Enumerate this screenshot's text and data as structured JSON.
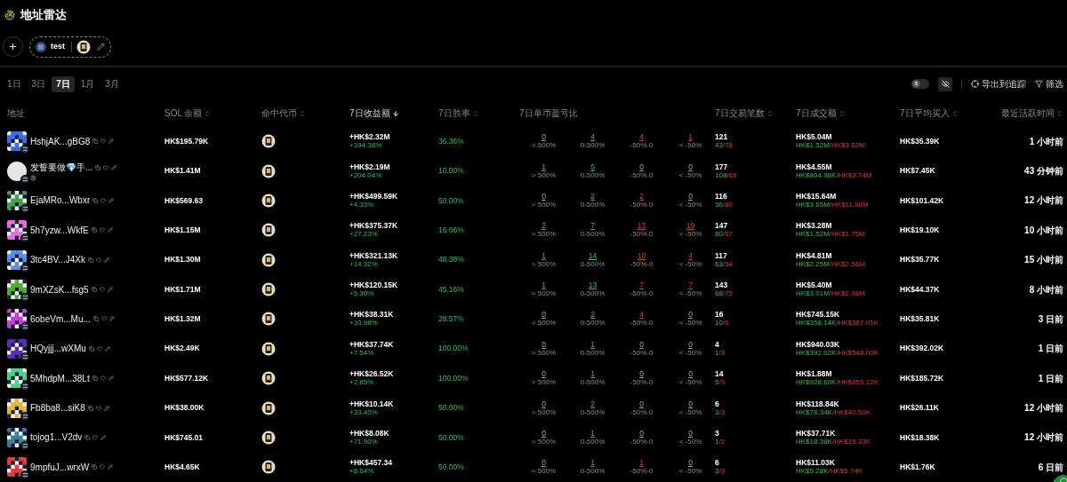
{
  "title": "地址雷达",
  "group": {
    "name": "test"
  },
  "periods": [
    {
      "label": "1日",
      "selected": false
    },
    {
      "label": "3日",
      "selected": false
    },
    {
      "label": "7日",
      "selected": true
    },
    {
      "label": "1月",
      "selected": false
    },
    {
      "label": "3月",
      "selected": false
    }
  ],
  "toolbar": {
    "currency_toggle": {
      "symbol": "$",
      "on": false
    },
    "export_label": "导出到追踪",
    "filter_label": "筛选"
  },
  "columns": [
    {
      "label": "地址",
      "sortable": false,
      "sorted": false
    },
    {
      "label": "SOL 余额",
      "sortable": true,
      "sorted": false
    },
    {
      "label": "命中代币",
      "sortable": true,
      "sorted": false
    },
    {
      "label": "7日收益额",
      "sortable": true,
      "sorted": true
    },
    {
      "label": "7日胜率",
      "sortable": true,
      "sorted": false
    },
    {
      "label": "7日单币盈亏比",
      "sortable": false,
      "sorted": false
    },
    {
      "label": "7日交易笔数",
      "sortable": true,
      "sorted": false
    },
    {
      "label": "7日成交额",
      "sortable": true,
      "sorted": false
    },
    {
      "label": "7日平均买入",
      "sortable": true,
      "sorted": false
    },
    {
      "label": "最近活跃时间",
      "sortable": true,
      "sorted": false
    }
  ],
  "rows": [
    {
      "address": "HshjAK...gBG8",
      "avatar": {
        "kind": "identicon",
        "color": "#3b6fe0"
      },
      "extra_icon": false,
      "sol": "HK$195.79K",
      "pnl": "+HK$2.32M",
      "pnl_pct": "+194.38%",
      "win_rate": "36.36%",
      "buckets": [
        {
          "count": "0",
          "range": "> 500%",
          "kind": "neutral"
        },
        {
          "count": "4",
          "range": "0-500%",
          "kind": "gain"
        },
        {
          "count": "4",
          "range": "-50%-0",
          "kind": "loss"
        },
        {
          "count": "1",
          "range": "< -50%",
          "kind": "loss"
        }
      ],
      "trades": "121",
      "wins": "43",
      "losses": "/78",
      "volume": "HK$5.04M",
      "buy_vol": "HK$1.52M",
      "sell_vol": "/HK$3.52M",
      "avg_buy": "HK$35.39K",
      "last_active": "1 小时前"
    },
    {
      "address": "发誓要做💎手...",
      "avatar": {
        "kind": "blank",
        "color": "#e5e5e5"
      },
      "extra_icon": true,
      "sol": "HK$1.41M",
      "pnl": "+HK$2.19M",
      "pnl_pct": "+204.04%",
      "win_rate": "10.00%",
      "buckets": [
        {
          "count": "1",
          "range": "> 500%",
          "kind": "gain"
        },
        {
          "count": "5",
          "range": "0-500%",
          "kind": "gain"
        },
        {
          "count": "0",
          "range": "-50%-0",
          "kind": "neutral"
        },
        {
          "count": "0",
          "range": "< -50%",
          "kind": "neutral"
        }
      ],
      "trades": "177",
      "wins": "108",
      "losses": "/69",
      "volume": "HK$4.55M",
      "buy_vol": "HK$804.98K",
      "sell_vol": "/HK$3.74M",
      "avg_buy": "HK$7.45K",
      "last_active": "43 分钟前"
    },
    {
      "address": "EjaMRo...Wbxr",
      "avatar": {
        "kind": "identicon",
        "color": "#3fa34d"
      },
      "extra_icon": false,
      "sol": "HK$569.63",
      "pnl": "+HK$499.59K",
      "pnl_pct": "+4.33%",
      "win_rate": "50.00%",
      "buckets": [
        {
          "count": "0",
          "range": "> 500%",
          "kind": "neutral"
        },
        {
          "count": "2",
          "range": "0-500%",
          "kind": "gain"
        },
        {
          "count": "2",
          "range": "-50%-0",
          "kind": "loss"
        },
        {
          "count": "0",
          "range": "< -50%",
          "kind": "neutral"
        }
      ],
      "trades": "116",
      "wins": "36",
      "losses": "/80",
      "volume": "HK$15.64M",
      "buy_vol": "HK$3.65M",
      "sell_vol": "/HK$11.98M",
      "avg_buy": "HK$101.42K",
      "last_active": "12 小时前"
    },
    {
      "address": "5h7yzw...WkfE",
      "avatar": {
        "kind": "identicon",
        "color": "#e56fd8"
      },
      "extra_icon": false,
      "sol": "HK$1.15M",
      "pnl": "+HK$375.37K",
      "pnl_pct": "+27.23%",
      "win_rate": "16.66%",
      "buckets": [
        {
          "count": "2",
          "range": "> 500%",
          "kind": "gain"
        },
        {
          "count": "7",
          "range": "0-500%",
          "kind": "gain"
        },
        {
          "count": "13",
          "range": "-50%-0",
          "kind": "loss"
        },
        {
          "count": "19",
          "range": "< -50%",
          "kind": "loss"
        }
      ],
      "trades": "147",
      "wins": "80",
      "losses": "/67",
      "volume": "HK$3.28M",
      "buy_vol": "HK$1.52M",
      "sell_vol": "/HK$1.75M",
      "avg_buy": "HK$19.10K",
      "last_active": "10 小时前"
    },
    {
      "address": "3tc4BV...J4Xk",
      "avatar": {
        "kind": "identicon",
        "color": "#5b8cf0"
      },
      "extra_icon": false,
      "sol": "HK$1.30M",
      "pnl": "+HK$321.13K",
      "pnl_pct": "+14.32%",
      "win_rate": "48.38%",
      "buckets": [
        {
          "count": "1",
          "range": "> 500%",
          "kind": "gain"
        },
        {
          "count": "14",
          "range": "0-500%",
          "kind": "gain"
        },
        {
          "count": "10",
          "range": "-50%-0",
          "kind": "loss"
        },
        {
          "count": "4",
          "range": "< -50%",
          "kind": "loss"
        }
      ],
      "trades": "117",
      "wins": "63",
      "losses": "/54",
      "volume": "HK$4.81M",
      "buy_vol": "HK$2.25M",
      "sell_vol": "/HK$2.56M",
      "avg_buy": "HK$35.77K",
      "last_active": "15 小时前"
    },
    {
      "address": "9mXZsK...fsg5",
      "avatar": {
        "kind": "identicon",
        "color": "#4caf3c"
      },
      "extra_icon": false,
      "sol": "HK$1.71M",
      "pnl": "+HK$120.15K",
      "pnl_pct": "+5.30%",
      "win_rate": "45.16%",
      "buckets": [
        {
          "count": "1",
          "range": "> 500%",
          "kind": "gain"
        },
        {
          "count": "13",
          "range": "0-500%",
          "kind": "gain"
        },
        {
          "count": "7",
          "range": "-50%-0",
          "kind": "loss"
        },
        {
          "count": "7",
          "range": "< -50%",
          "kind": "loss"
        }
      ],
      "trades": "143",
      "wins": "68",
      "losses": "/75",
      "volume": "HK$5.40M",
      "buy_vol": "HK$3.01M",
      "sell_vol": "/HK$2.38M",
      "avg_buy": "HK$44.37K",
      "last_active": "8 小时前"
    },
    {
      "address": "6obeVm...Mu...",
      "avatar": {
        "kind": "identicon",
        "color": "#c63fd6"
      },
      "extra_icon": false,
      "sol": "HK$1.32M",
      "pnl": "+HK$38.31K",
      "pnl_pct": "+10.98%",
      "win_rate": "28.57%",
      "buckets": [
        {
          "count": "0",
          "range": "> 500%",
          "kind": "neutral"
        },
        {
          "count": "2",
          "range": "0-500%",
          "kind": "gain"
        },
        {
          "count": "4",
          "range": "-50%-0",
          "kind": "loss"
        },
        {
          "count": "0",
          "range": "< -50%",
          "kind": "neutral"
        }
      ],
      "trades": "16",
      "wins": "10",
      "losses": "/6",
      "volume": "HK$745.15K",
      "buy_vol": "HK$358.14K",
      "sell_vol": "/HK$387.01K",
      "avg_buy": "HK$35.81K",
      "last_active": "3 日前"
    },
    {
      "address": "HQyjjj...wXMu",
      "avatar": {
        "kind": "identicon",
        "color": "#5a2fc0"
      },
      "extra_icon": false,
      "sol": "HK$2.49K",
      "pnl": "+HK$37.74K",
      "pnl_pct": "+7.54%",
      "win_rate": "100.00%",
      "buckets": [
        {
          "count": "0",
          "range": "> 500%",
          "kind": "neutral"
        },
        {
          "count": "1",
          "range": "0-500%",
          "kind": "gain"
        },
        {
          "count": "0",
          "range": "-50%-0",
          "kind": "neutral"
        },
        {
          "count": "0",
          "range": "< -50%",
          "kind": "neutral"
        }
      ],
      "trades": "4",
      "wins": "1",
      "losses": "/3",
      "volume": "HK$940.03K",
      "buy_vol": "HK$392.02K",
      "sell_vol": "/HK$548.00K",
      "avg_buy": "HK$392.02K",
      "last_active": "1 日前"
    },
    {
      "address": "5MhdpM...38Lt",
      "avatar": {
        "kind": "identicon",
        "color": "#45d68a"
      },
      "extra_icon": false,
      "sol": "HK$577.12K",
      "pnl": "+HK$26.52K",
      "pnl_pct": "+2.85%",
      "win_rate": "100.00%",
      "buckets": [
        {
          "count": "0",
          "range": "> 500%",
          "kind": "neutral"
        },
        {
          "count": "1",
          "range": "0-500%",
          "kind": "gain"
        },
        {
          "count": "0",
          "range": "-50%-0",
          "kind": "neutral"
        },
        {
          "count": "0",
          "range": "< -50%",
          "kind": "neutral"
        }
      ],
      "trades": "14",
      "wins": "5",
      "losses": "/9",
      "volume": "HK$1.88M",
      "buy_vol": "HK$928.60K",
      "sell_vol": "/HK$955.12K",
      "avg_buy": "HK$185.72K",
      "last_active": "1 日前"
    },
    {
      "address": "Fb8ba8...siK8",
      "avatar": {
        "kind": "identicon",
        "color": "#e0b83a"
      },
      "extra_icon": false,
      "sol": "HK$38.00K",
      "pnl": "+HK$10.14K",
      "pnl_pct": "+33.40%",
      "win_rate": "50.00%",
      "buckets": [
        {
          "count": "0",
          "range": "> 500%",
          "kind": "neutral"
        },
        {
          "count": "2",
          "range": "0-500%",
          "kind": "gain"
        },
        {
          "count": "0",
          "range": "-50%-0",
          "kind": "neutral"
        },
        {
          "count": "0",
          "range": "< -50%",
          "kind": "neutral"
        }
      ],
      "trades": "6",
      "wins": "3",
      "losses": "/3",
      "volume": "HK$118.84K",
      "buy_vol": "HK$78.34K",
      "sell_vol": "/HK$40.50K",
      "avg_buy": "HK$26.11K",
      "last_active": "12 小时前"
    },
    {
      "address": "tojog1...V2dv",
      "avatar": {
        "kind": "identicon",
        "color": "#3a7fa0"
      },
      "extra_icon": false,
      "sol": "HK$745.01",
      "pnl": "+HK$8.08K",
      "pnl_pct": "+71.90%",
      "win_rate": "50.00%",
      "buckets": [
        {
          "count": "0",
          "range": "> 500%",
          "kind": "neutral"
        },
        {
          "count": "1",
          "range": "0-500%",
          "kind": "gain"
        },
        {
          "count": "0",
          "range": "-50%-0",
          "kind": "neutral"
        },
        {
          "count": "0",
          "range": "< -50%",
          "kind": "neutral"
        }
      ],
      "trades": "3",
      "wins": "1",
      "losses": "/2",
      "volume": "HK$37.71K",
      "buy_vol": "HK$18.38K",
      "sell_vol": "/HK$19.33K",
      "avg_buy": "HK$18.38K",
      "last_active": "12 小时前"
    },
    {
      "address": "9mpfuJ...wrxW",
      "avatar": {
        "kind": "identicon",
        "color": "#e03a3a"
      },
      "extra_icon": false,
      "sol": "HK$4.65K",
      "pnl": "+HK$457.34",
      "pnl_pct": "+8.64%",
      "win_rate": "50.00%",
      "buckets": [
        {
          "count": "0",
          "range": "> 500%",
          "kind": "neutral"
        },
        {
          "count": "1",
          "range": "0-500%",
          "kind": "gain"
        },
        {
          "count": "1",
          "range": "-50%-0",
          "kind": "loss"
        },
        {
          "count": "0",
          "range": "< -50%",
          "kind": "neutral"
        }
      ],
      "trades": "6",
      "wins": "3",
      "losses": "/3",
      "volume": "HK$11.03K",
      "buy_vol": "HK$5.28K",
      "sell_vol": "/HK$5.74K",
      "avg_buy": "HK$1.76K",
      "last_active": "6 日前"
    }
  ]
}
